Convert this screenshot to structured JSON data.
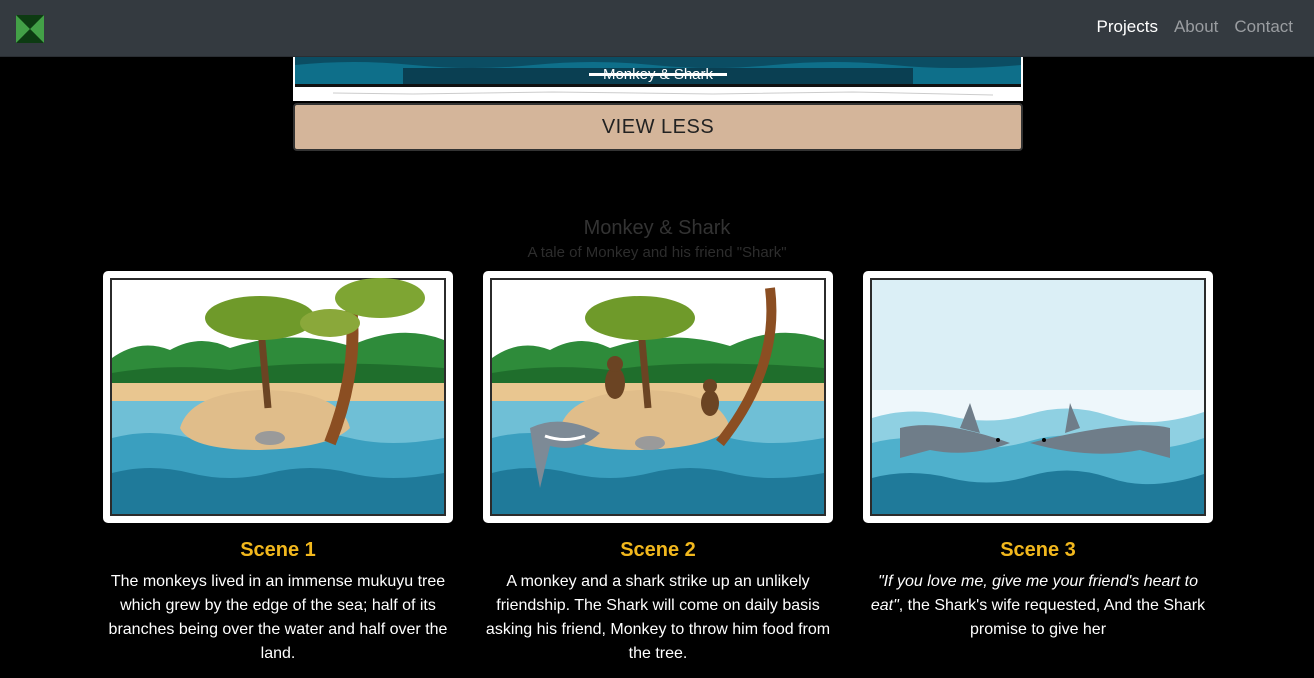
{
  "nav": {
    "logo_icon": "green-diamond-logo-icon",
    "links": [
      {
        "label": "Projects",
        "active": true
      },
      {
        "label": "About",
        "active": false
      },
      {
        "label": "Contact",
        "active": false
      }
    ]
  },
  "top_card": {
    "caption": "Monkey & Shark"
  },
  "view_less_label": "VIEW LESS",
  "section": {
    "title": "Monkey & Shark",
    "subtitle": "A tale of Monkey and his friend \"Shark\""
  },
  "scenes": [
    {
      "title": "Scene 1",
      "text": "The monkeys lived in an immense mukuyu tree which grew by the edge of the sea; half of its branches being over the water and half over the land."
    },
    {
      "title": "Scene 2",
      "text": "A monkey and a shark strike up an unlikely friendship. The Shark will come on daily basis asking his friend, Monkey to throw him food from the tree."
    },
    {
      "title": "Scene 3",
      "quote": "\"If you love me, give me your friend's heart to eat\"",
      "text": ", the Shark's wife requested, And the Shark promise to give her"
    }
  ],
  "colors": {
    "navbar": "#343a40",
    "accent_title": "#f2b81d",
    "button_bg": "#d4b59a"
  }
}
